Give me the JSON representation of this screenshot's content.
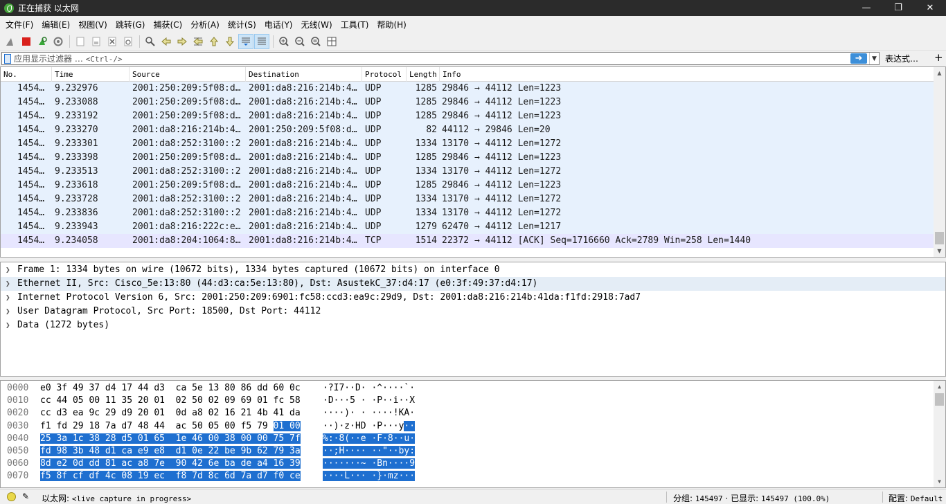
{
  "window": {
    "title": "正在捕获 以太网"
  },
  "menu": [
    "文件(F)",
    "编辑(E)",
    "视图(V)",
    "跳转(G)",
    "捕获(C)",
    "分析(A)",
    "统计(S)",
    "电话(Y)",
    "无线(W)",
    "工具(T)",
    "帮助(H)"
  ],
  "toolbar_icons": [
    "shark-fin-start-icon",
    "stop-capture-icon",
    "restart-capture-icon",
    "capture-options-icon",
    "open-file-icon",
    "save-file-icon",
    "close-file-icon",
    "reload-file-icon",
    "find-packet-icon",
    "go-back-icon",
    "go-forward-icon",
    "go-to-packet-icon",
    "first-packet-icon",
    "last-packet-icon",
    "autoscroll-icon",
    "colorize-icon",
    "zoom-in-icon",
    "zoom-out-icon",
    "normal-size-icon",
    "resize-columns-icon"
  ],
  "filter": {
    "placeholder": "应用显示过滤器 …",
    "shortcut": "<Ctrl-/>",
    "expression_label": "表达式…",
    "add_label": "+"
  },
  "columns": [
    "No.",
    "Time",
    "Source",
    "Destination",
    "Protocol",
    "Length",
    "Info"
  ],
  "packets": [
    {
      "no": "1454…",
      "time": "9.232976",
      "src": "2001:250:209:5f08:d…",
      "dst": "2001:da8:216:214b:4…",
      "proto": "UDP",
      "len": "1285",
      "info": "29846 → 44112 Len=1223"
    },
    {
      "no": "1454…",
      "time": "9.233088",
      "src": "2001:250:209:5f08:d…",
      "dst": "2001:da8:216:214b:4…",
      "proto": "UDP",
      "len": "1285",
      "info": "29846 → 44112 Len=1223"
    },
    {
      "no": "1454…",
      "time": "9.233192",
      "src": "2001:250:209:5f08:d…",
      "dst": "2001:da8:216:214b:4…",
      "proto": "UDP",
      "len": "1285",
      "info": "29846 → 44112 Len=1223"
    },
    {
      "no": "1454…",
      "time": "9.233270",
      "src": "2001:da8:216:214b:4…",
      "dst": "2001:250:209:5f08:d…",
      "proto": "UDP",
      "len": "82",
      "info": "44112 → 29846 Len=20"
    },
    {
      "no": "1454…",
      "time": "9.233301",
      "src": "2001:da8:252:3100::2",
      "dst": "2001:da8:216:214b:4…",
      "proto": "UDP",
      "len": "1334",
      "info": "13170 → 44112 Len=1272"
    },
    {
      "no": "1454…",
      "time": "9.233398",
      "src": "2001:250:209:5f08:d…",
      "dst": "2001:da8:216:214b:4…",
      "proto": "UDP",
      "len": "1285",
      "info": "29846 → 44112 Len=1223"
    },
    {
      "no": "1454…",
      "time": "9.233513",
      "src": "2001:da8:252:3100::2",
      "dst": "2001:da8:216:214b:4…",
      "proto": "UDP",
      "len": "1334",
      "info": "13170 → 44112 Len=1272"
    },
    {
      "no": "1454…",
      "time": "9.233618",
      "src": "2001:250:209:5f08:d…",
      "dst": "2001:da8:216:214b:4…",
      "proto": "UDP",
      "len": "1285",
      "info": "29846 → 44112 Len=1223"
    },
    {
      "no": "1454…",
      "time": "9.233728",
      "src": "2001:da8:252:3100::2",
      "dst": "2001:da8:216:214b:4…",
      "proto": "UDP",
      "len": "1334",
      "info": "13170 → 44112 Len=1272"
    },
    {
      "no": "1454…",
      "time": "9.233836",
      "src": "2001:da8:252:3100::2",
      "dst": "2001:da8:216:214b:4…",
      "proto": "UDP",
      "len": "1334",
      "info": "13170 → 44112 Len=1272"
    },
    {
      "no": "1454…",
      "time": "9.233943",
      "src": "2001:da8:216:222c:e…",
      "dst": "2001:da8:216:214b:4…",
      "proto": "UDP",
      "len": "1279",
      "info": "62470 → 44112 Len=1217"
    },
    {
      "no": "1454…",
      "time": "9.234058",
      "src": "2001:da8:204:1064:8…",
      "dst": "2001:da8:216:214b:4…",
      "proto": "TCP",
      "len": "1514",
      "info": "22372 → 44112 [ACK] Seq=1716660 Ack=2789 Win=258 Len=1440"
    }
  ],
  "details": [
    "Frame 1: 1334 bytes on wire (10672 bits), 1334 bytes captured (10672 bits) on interface 0",
    "Ethernet II, Src: Cisco_5e:13:80 (44:d3:ca:5e:13:80), Dst: AsustekC_37:d4:17 (e0:3f:49:37:d4:17)",
    "Internet Protocol Version 6, Src: 2001:250:209:6901:fc58:ccd3:ea9c:29d9, Dst: 2001:da8:216:214b:41da:f1fd:2918:7ad7",
    "User Datagram Protocol, Src Port: 18500, Dst Port: 44112",
    "Data (1272 bytes)"
  ],
  "details_selected": 1,
  "hex_rows": [
    {
      "offset": "0000",
      "hex": "e0 3f 49 37 d4 17 44 d3  ca 5e 13 80 86 dd 60 0c",
      "hex_hl": "",
      "ascii": "·?I7··D· ·^····`·",
      "ascii_hl": ""
    },
    {
      "offset": "0010",
      "hex": "cc 44 05 00 11 35 20 01  02 50 02 09 69 01 fc 58",
      "hex_hl": "",
      "ascii": "·D···5 · ·P··i··X",
      "ascii_hl": ""
    },
    {
      "offset": "0020",
      "hex": "cc d3 ea 9c 29 d9 20 01  0d a8 02 16 21 4b 41 da",
      "hex_hl": "",
      "ascii": "····)· · ····!KA·",
      "ascii_hl": ""
    },
    {
      "offset": "0030",
      "hex": "f1 fd 29 18 7a d7 48 44  ac 50 05 00 f5 79 ",
      "hex_hl": "01 00",
      "ascii": "··)·z·HD ·P···y",
      "ascii_hl": "··"
    },
    {
      "offset": "0040",
      "hex": "",
      "hex_hl": "25 3a 1c 38 28 d5 01 65  1e 46 00 38 00 00 75 7f",
      "ascii": "",
      "ascii_hl": "%:·8(··e ·F·8··u·"
    },
    {
      "offset": "0050",
      "hex": "",
      "hex_hl": "fd 98 3b 48 d1 ca e9 e8  d1 0e 22 be 9b 62 79 3a",
      "ascii": "",
      "ascii_hl": "··;H···· ··\"··by:"
    },
    {
      "offset": "0060",
      "hex": "",
      "hex_hl": "8d e2 0d dd 81 ac a8 7e  90 42 6e ba de a4 16 39",
      "ascii": "",
      "ascii_hl": "·······~ ·Bn····9"
    },
    {
      "offset": "0070",
      "hex": "",
      "hex_hl": "f5 8f cf df 4c 08 19 ec  f8 7d 8c 6d 7a d7 f0 ce",
      "ascii": "",
      "ascii_hl": "····L··· ·}·mz···"
    }
  ],
  "status": {
    "interface_label": "以太网:",
    "interface_state": "<live capture in progress>",
    "packets_label": "分组:",
    "packets_count": "145497",
    "displayed_label": "· 已显示:",
    "displayed_count": "145497 (100.0%)",
    "profile_label": "配置:",
    "profile_name": "Default"
  },
  "colors": {
    "udp_row": "#e7f1fd",
    "tcp_row": "#e7e6ff",
    "selection": "#1e6fd0",
    "titlebar": "#2b2b2b"
  }
}
